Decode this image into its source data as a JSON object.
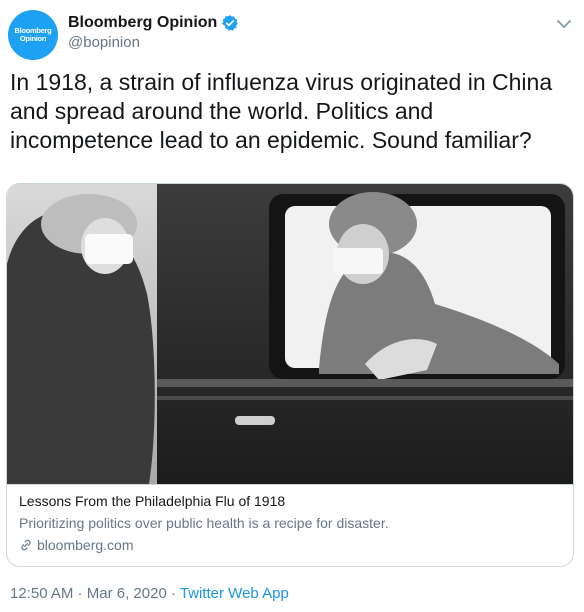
{
  "account": {
    "avatar_line1": "Bloomberg",
    "avatar_line2": "Opinion",
    "display_name": "Bloomberg Opinion",
    "handle": "@bopinion",
    "avatar_color": "#1da1f2",
    "verified_icon": "verified-badge-icon"
  },
  "tweet": {
    "text": "In 1918, a strain of influenza virus originated in China and spread around the world. Politics and incompetence lead to an epidemic. Sound familiar?"
  },
  "card": {
    "title": "Lessons From the Philadelphia Flu of 1918",
    "description": "Prioritizing politics over public health is a recipe for disaster.",
    "domain": "bloomberg.com",
    "image_subject": "black-and-white photo of two women wearing face masks by a car window"
  },
  "footer": {
    "time": "12:50 AM",
    "separator": " · ",
    "date": "Mar 6, 2020",
    "app": "Twitter Web App"
  },
  "colors": {
    "text": "#14171a",
    "secondary": "#657786",
    "link": "#1b95e0",
    "border": "#ccd6dd"
  }
}
